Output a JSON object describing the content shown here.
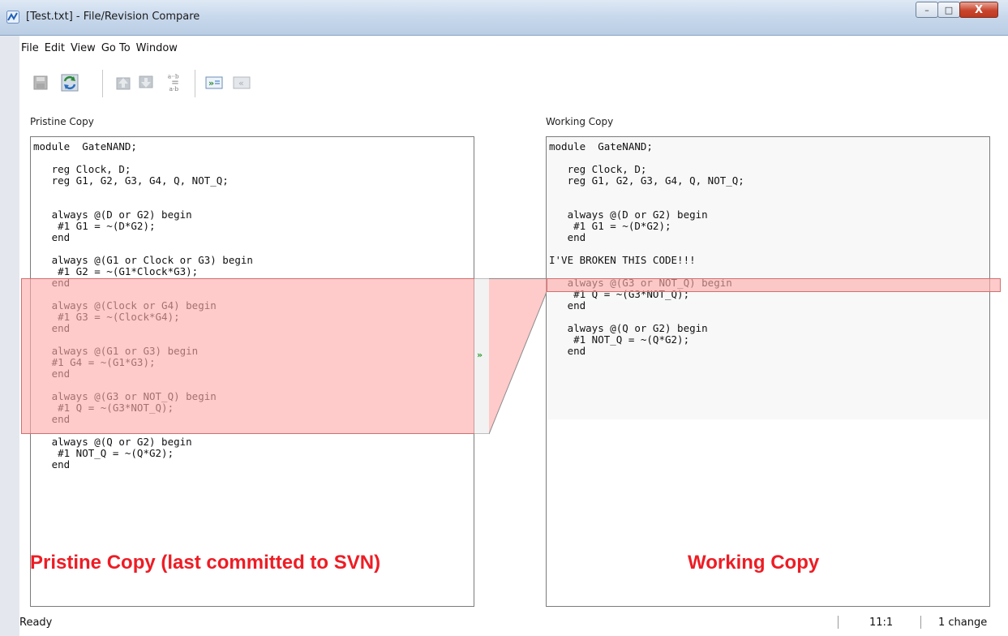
{
  "window": {
    "title": "[Test.txt] - File/Revision Compare",
    "controls": {
      "minimize": "–",
      "maximize": "□",
      "close": "X"
    }
  },
  "menu": {
    "items": [
      "File",
      "Edit",
      "View",
      "Go To",
      "Window"
    ]
  },
  "toolbar": {
    "buttons": [
      {
        "icon": "save-icon",
        "enabled": false
      },
      {
        "icon": "refresh-swap-icon",
        "enabled": true
      },
      {
        "icon": "previous-change-icon",
        "enabled": false
      },
      {
        "icon": "next-change-icon",
        "enabled": false
      },
      {
        "icon": "compare-options-icon",
        "enabled": false
      },
      {
        "icon": "copy-right-icon",
        "enabled": true
      },
      {
        "icon": "copy-left-icon",
        "enabled": false
      }
    ]
  },
  "left_pane": {
    "label": "Pristine Copy",
    "lines": [
      "module  GateNAND;",
      "",
      "   reg Clock, D;",
      "   reg G1, G2, G3, G4, Q, NOT_Q;",
      "",
      "",
      "   always @(D or G2) begin",
      "    #1 G1 = ~(D*G2);",
      "   end",
      "",
      "   always @(G1 or Clock or G3) begin",
      "    #1 G2 = ~(G1*Clock*G3);",
      "   end",
      "",
      "   always @(Clock or G4) begin",
      "    #1 G3 = ~(Clock*G4);",
      "   end",
      "",
      "   always @(G1 or G3) begin",
      "   #1 G4 = ~(G1*G3);",
      "   end",
      "",
      "   always @(G3 or NOT_Q) begin",
      "    #1 Q = ~(G3*NOT_Q);",
      "   end",
      "",
      "   always @(Q or G2) begin",
      "    #1 NOT_Q = ~(Q*G2);",
      "   end"
    ]
  },
  "right_pane": {
    "label": "Working Copy",
    "lines": [
      "module  GateNAND;",
      "",
      "   reg Clock, D;",
      "   reg G1, G2, G3, G4, Q, NOT_Q;",
      "",
      "",
      "   always @(D or G2) begin",
      "    #1 G1 = ~(D*G2);",
      "   end",
      "",
      "I'VE BROKEN THIS CODE!!!",
      "",
      "   always @(G3 or NOT_Q) begin",
      "    #1 Q = ~(G3*NOT_Q);",
      "   end",
      "",
      "   always @(Q or G2) begin",
      "    #1 NOT_Q = ~(Q*G2);",
      "   end"
    ]
  },
  "gutter": {
    "arrow": "»"
  },
  "overlays": {
    "left": "Pristine Copy (last committed to SVN)",
    "right": "Working Copy"
  },
  "status": {
    "ready": "Ready",
    "position": "11:1",
    "changes": "1 change"
  },
  "colors": {
    "diff_fill": "#ffaaaa",
    "diff_border": "#d07070",
    "overlay_text": "#ee1c24",
    "gutter_arrow": "#2e9a2e"
  }
}
